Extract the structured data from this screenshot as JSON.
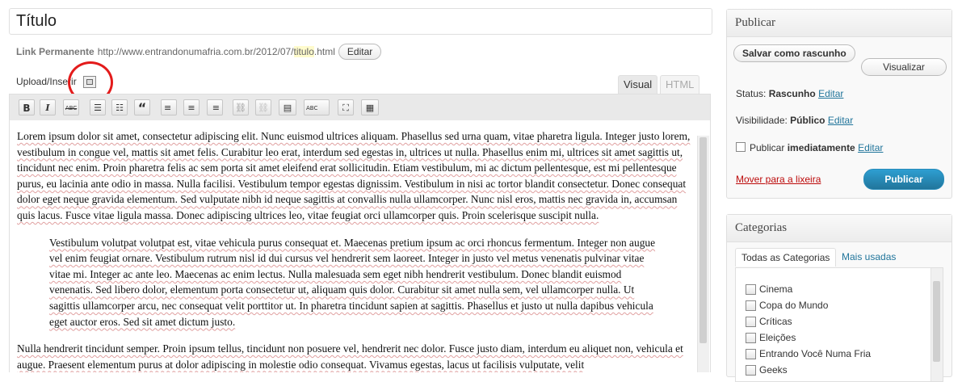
{
  "post": {
    "title": "Título",
    "permalink_label": "Link Permanente",
    "permalink_prefix": "http://www.entrandonumafria.com.br/2012/07/",
    "permalink_slug": "titulo",
    "permalink_suffix": ".html",
    "edit_permalink_label": "Editar"
  },
  "media": {
    "upload_label": "Upload/Inserir"
  },
  "editor": {
    "tabs": [
      {
        "label": "Visual",
        "active": true
      },
      {
        "label": "HTML",
        "active": false
      }
    ],
    "toolbar": [
      {
        "name": "bold-button",
        "glyph": "B"
      },
      {
        "name": "italic-button",
        "glyph": "I"
      },
      {
        "name": "strikethrough-button",
        "glyph": "ABC"
      },
      {
        "name": "bullet-list-button",
        "glyph": "☰"
      },
      {
        "name": "numbered-list-button",
        "glyph": "☷"
      },
      {
        "name": "blockquote-button",
        "glyph": "“"
      },
      {
        "name": "align-left-button",
        "glyph": "≡"
      },
      {
        "name": "align-center-button",
        "glyph": "≡"
      },
      {
        "name": "align-right-button",
        "glyph": "≡"
      },
      {
        "name": "insert-link-button",
        "glyph": "⛓"
      },
      {
        "name": "unlink-button",
        "glyph": "⛓"
      },
      {
        "name": "more-tag-button",
        "glyph": "▤"
      },
      {
        "name": "spellcheck-button",
        "glyph": "ABC"
      },
      {
        "name": "fullscreen-button",
        "glyph": "⛶"
      },
      {
        "name": "kitchen-sink-button",
        "glyph": "▦"
      }
    ],
    "paragraphs": [
      "Lorem ipsum dolor sit amet, consectetur adipiscing elit. Nunc euismod ultrices aliquam. Phasellus sed urna quam, vitae pharetra ligula. Integer justo lorem, vestibulum in congue vel, mattis sit amet felis. Curabitur leo erat, interdum sed egestas in, ultrices ut nulla. Phasellus enim mi, ultrices sit amet sagittis ut, tincidunt nec enim. Proin pharetra felis ac sem porta sit amet eleifend erat sollicitudin. Etiam vestibulum, mi ac dictum pellentesque, est mi pellentesque purus, eu lacinia ante odio in massa. Nulla facilisi. Vestibulum tempor egestas dignissim. Vestibulum in nisi ac tortor blandit consectetur. Donec consequat dolor eget neque gravida elementum. Sed vulputate nibh id neque sagittis at convallis nulla ullamcorper. Nunc nisl eros, mattis nec gravida in, accumsan quis lacus. Fusce vitae ligula massa. Donec adipiscing ultrices leo, vitae feugiat orci ullamcorper quis. Proin scelerisque suscipit nulla.",
      "Vestibulum volutpat volutpat est, vitae vehicula purus consequat et. Maecenas pretium ipsum ac orci rhoncus fermentum. Integer non augue vel enim feugiat ornare. Vestibulum rutrum nisl id dui cursus vel hendrerit sem laoreet. Integer in justo vel metus venenatis pulvinar vitae vitae mi. Integer ac ante leo. Maecenas ac enim lectus. Nulla malesuada sem eget nibh hendrerit vestibulum. Donec blandit euismod venenatis. Sed libero dolor, elementum porta consectetur ut, aliquam quis dolor. Curabitur sit amet nulla sem, vel ullamcorper nulla. Ut sagittis ullamcorper arcu, nec consequat velit porttitor ut. In pharetra tincidunt sapien at sagittis. Phasellus et justo ut nulla dapibus vehicula eget auctor eros. Sed sit amet dictum justo.",
      "Nulla hendrerit tincidunt semper. Proin ipsum tellus, tincidunt non posuere vel, hendrerit nec dolor. Fusce justo diam, interdum eu aliquet non, vehicula et augue. Praesent elementum purus at dolor adipiscing in molestie odio consequat. Vivamus egestas, lacus ut facilisis vulputate, velit"
    ]
  },
  "publish": {
    "title": "Publicar",
    "save_draft_label": "Salvar como rascunho",
    "preview_label": "Visualizar",
    "status_label": "Status:",
    "status_value": "Rascunho",
    "visibility_label": "Visibilidade:",
    "visibility_value": "Público",
    "schedule_label": "Publicar",
    "schedule_value": "imediatamente",
    "edit_label": "Editar",
    "trash_label": "Mover para a lixeira",
    "publish_label": "Publicar"
  },
  "categories": {
    "title": "Categorias",
    "tab_all": "Todas as Categorias",
    "tab_popular": "Mais usadas",
    "items": [
      "Cinema",
      "Copa do Mundo",
      "Críticas",
      "Eleições",
      "Entrando Você Numa Fria",
      "Geeks"
    ]
  }
}
